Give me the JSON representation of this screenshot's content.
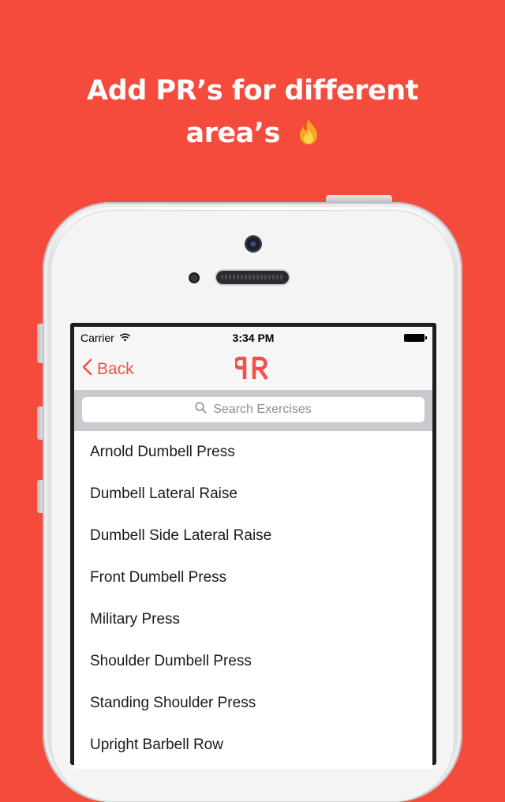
{
  "headline": {
    "line1": "Add PR’s for different",
    "line2": "area’s"
  },
  "icons": {
    "headline_emoji": "fire-icon",
    "back": "chevron-left-icon",
    "search": "magnifier-icon",
    "wifi": "wifi-icon"
  },
  "status_bar": {
    "carrier": "Carrier",
    "time": "3:34 PM"
  },
  "nav": {
    "back_label": "Back"
  },
  "search": {
    "placeholder": "Search Exercises"
  },
  "exercises": [
    "Arnold Dumbell Press",
    "Dumbell Lateral Raise",
    "Dumbell Side Lateral Raise",
    "Front Dumbell Press",
    "Military Press",
    "Shoulder Dumbell Press",
    "Standing Shoulder Press",
    "Upright Barbell Row"
  ],
  "colors": {
    "background": "#F54B3C",
    "accent": "#F1524A"
  }
}
